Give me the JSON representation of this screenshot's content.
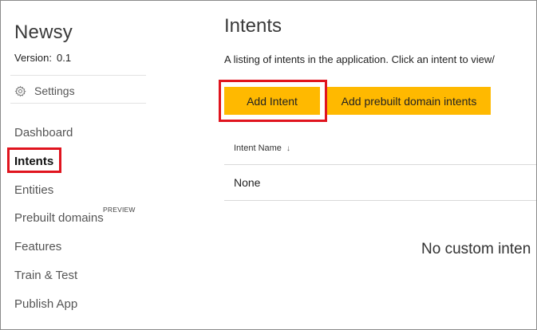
{
  "sidebar": {
    "app_name": "Newsy",
    "version_label": "Version:",
    "version_value": "0.1",
    "settings_label": "Settings",
    "nav": {
      "dashboard": "Dashboard",
      "intents": "Intents",
      "entities": "Entities",
      "prebuilt_domains": "Prebuilt domains",
      "prebuilt_badge": "PREVIEW",
      "features": "Features",
      "train_test": "Train & Test",
      "publish_app": "Publish App"
    },
    "active_item": "Intents"
  },
  "main": {
    "title": "Intents",
    "description": "A listing of intents in the application. Click an intent to view/",
    "buttons": {
      "add_intent": "Add Intent",
      "add_prebuilt": "Add prebuilt domain intents"
    },
    "table": {
      "column_header": "Intent Name",
      "sort_indicator": "↓",
      "rows": [
        "None"
      ]
    },
    "empty_message": "No custom inten"
  },
  "colors": {
    "accent_button": "#ffb900",
    "highlight_box": "#e0141e"
  },
  "icons": {
    "settings": "gear-icon",
    "sort": "sort-down-arrow"
  }
}
